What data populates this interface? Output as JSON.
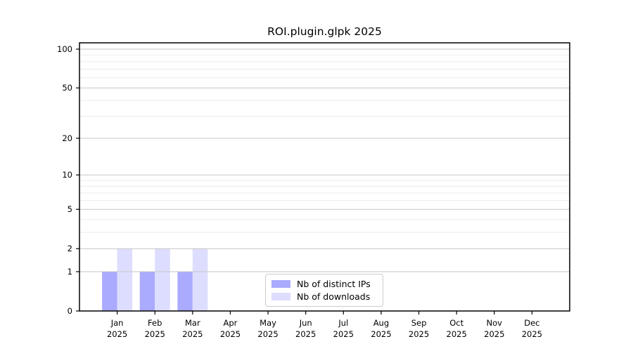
{
  "title": "ROI.plugin.glpk 2025",
  "legend": {
    "items": [
      {
        "label": "Nb of distinct IPs",
        "color": "#aaaaff"
      },
      {
        "label": "Nb of downloads",
        "color": "#ddddff"
      }
    ],
    "border_color": "#cccccc"
  },
  "chart_data": {
    "type": "bar",
    "title": "ROI.plugin.glpk 2025",
    "categories": [
      "Jan 2025",
      "Feb 2025",
      "Mar 2025",
      "Apr 2025",
      "May 2025",
      "Jun 2025",
      "Jul 2025",
      "Aug 2025",
      "Sep 2025",
      "Oct 2025",
      "Nov 2025",
      "Dec 2025"
    ],
    "months": [
      "Jan",
      "Feb",
      "Mar",
      "Apr",
      "May",
      "Jun",
      "Jul",
      "Aug",
      "Sep",
      "Oct",
      "Nov",
      "Dec"
    ],
    "year_label": "2025",
    "series": [
      {
        "name": "Nb of distinct IPs",
        "color": "#aaaaff",
        "values": [
          1,
          1,
          1,
          0,
          0,
          0,
          0,
          0,
          0,
          0,
          0,
          0
        ]
      },
      {
        "name": "Nb of downloads",
        "color": "#ddddff",
        "values": [
          2,
          2,
          2,
          0,
          0,
          0,
          0,
          0,
          0,
          0,
          0,
          0
        ]
      }
    ],
    "xlabel": "",
    "ylabel": "",
    "yscale": "log1p",
    "y_major_ticks": [
      0,
      1,
      2,
      5,
      10,
      20,
      50,
      100
    ],
    "y_minor_gridlines": [
      3,
      4,
      6,
      7,
      8,
      9,
      30,
      40,
      60,
      70,
      80,
      90
    ],
    "ylim": [
      0,
      112
    ],
    "grid": "horizontal",
    "grid_on_top_of_bars": true,
    "legend_position": "bottom-center",
    "colors": {
      "major_grid": "#c6c6c6",
      "minor_grid": "#ebebeb",
      "spine": "#000000",
      "tick_label": "#000000"
    }
  }
}
